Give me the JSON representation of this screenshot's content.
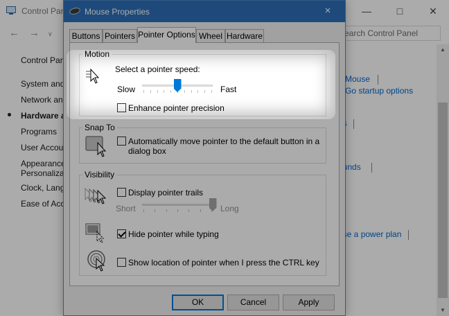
{
  "control_panel": {
    "title": "Control Panel",
    "search_placeholder": "Search Control Panel",
    "sidebar": [
      {
        "label": "Control Panel Home",
        "selected": false
      },
      {
        "label": "System and Security",
        "selected": false
      },
      {
        "label": "Network and Internet",
        "selected": false
      },
      {
        "label": "Hardware and Sound",
        "selected": true
      },
      {
        "label": "Programs",
        "selected": false
      },
      {
        "label": "User Accounts",
        "selected": false
      },
      {
        "label": "Appearance and",
        "selected": false
      },
      {
        "label": "Personalization",
        "selected": false
      },
      {
        "label": "Clock, Language",
        "selected": false
      },
      {
        "label": "Ease of Access",
        "selected": false
      }
    ],
    "links": {
      "mouse": "Mouse",
      "startup": "o Go startup options",
      "es": "es",
      "sounds": "ounds",
      "power": "ose a power plan"
    }
  },
  "dialog": {
    "title": "Mouse Properties",
    "close_glyph": "×",
    "tabs": [
      {
        "label": "Buttons",
        "active": false
      },
      {
        "label": "Pointers",
        "active": false
      },
      {
        "label": "Pointer Options",
        "active": true
      },
      {
        "label": "Wheel",
        "active": false
      },
      {
        "label": "Hardware",
        "active": false
      }
    ],
    "motion": {
      "title": "Motion",
      "speed_label": "Select a pointer speed:",
      "slow": "Slow",
      "fast": "Fast",
      "speed_fraction": 0.5,
      "enhance_label": "Enhance pointer precision",
      "enhance_checked": false
    },
    "snap_to": {
      "title": "Snap To",
      "label_line1": "Automatically move pointer to the default button in a",
      "label_line2": "dialog box",
      "checked": false
    },
    "visibility": {
      "title": "Visibility",
      "trails_label": "Display pointer trails",
      "trails_checked": false,
      "short": "Short",
      "long": "Long",
      "trail_fraction": 1.0,
      "hide_label": "Hide pointer while typing",
      "hide_checked": true,
      "ctrl_label": "Show location of pointer when I press the CTRL key",
      "ctrl_checked": false
    },
    "buttons": {
      "ok": "OK",
      "cancel": "Cancel",
      "apply": "Apply"
    }
  }
}
